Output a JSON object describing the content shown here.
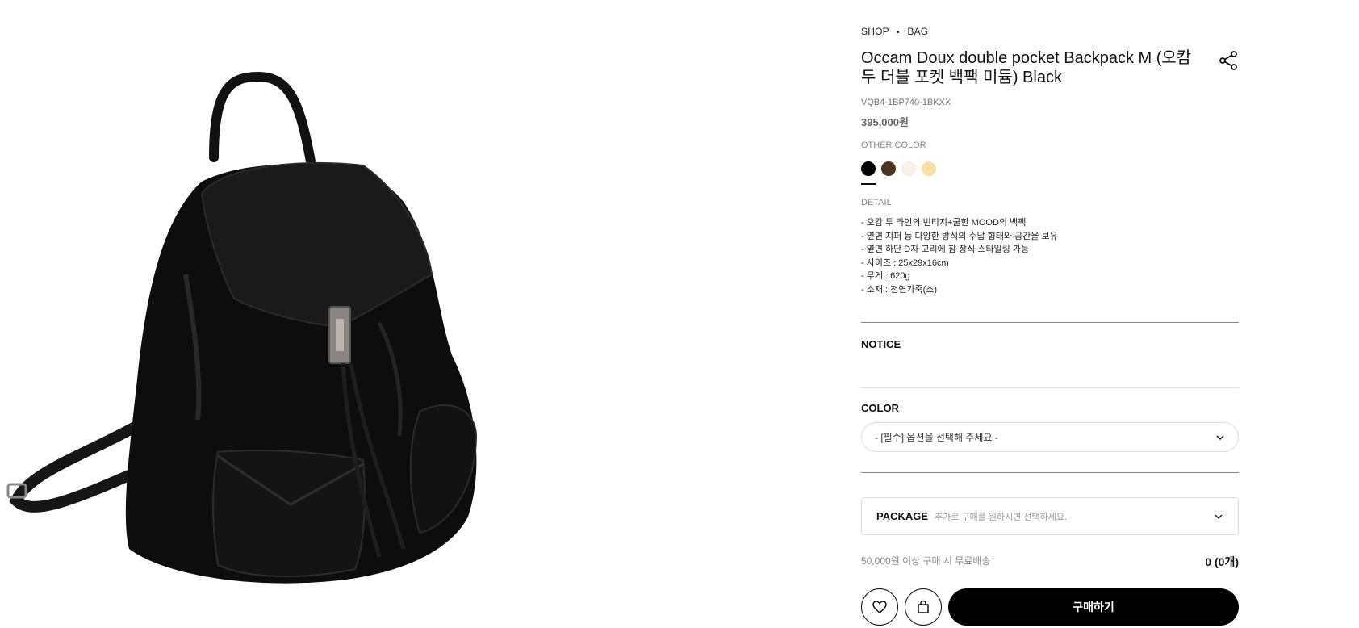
{
  "breadcrumb": {
    "shop": "SHOP",
    "separator": "•",
    "category": "BAG"
  },
  "product": {
    "title": "Occam Doux double pocket Backpack M (오캄 두 더블 포켓 백팩 미듐) Black",
    "sku": "VQB4-1BP740-1BKXX",
    "price": "395,000원",
    "image_alt": "black leather backpack"
  },
  "other_color": {
    "label": "OTHER COLOR",
    "swatches": [
      {
        "name": "black",
        "color": "#000000",
        "selected": true
      },
      {
        "name": "brown",
        "color": "#4a3520",
        "selected": false
      },
      {
        "name": "cream",
        "color": "#faf2e6",
        "selected": false
      },
      {
        "name": "beige",
        "color": "#fbe0a6",
        "selected": false
      }
    ]
  },
  "detail": {
    "label": "DETAIL",
    "lines": [
      "- 오캄 두 라인의 빈티지+쿨한 MOOD의 백팩",
      "- 옆면 지퍼 등 다양한 방식의 수납 형태와 공간을 보유",
      "- 옆면 하단 D자 고리에 참 장식 스타일링 가능",
      "- 사이즈 : 25x29x16cm",
      "- 무게 : 620g",
      "- 소재 : 천연가죽(소)"
    ]
  },
  "notice": {
    "label": "NOTICE"
  },
  "color_option": {
    "label": "COLOR",
    "placeholder": "- [필수] 옵션을 선택해 주세요 -"
  },
  "package": {
    "label": "PACKAGE",
    "hint": "추가로 구매를 원하시면 선택하세요."
  },
  "shipping": {
    "text": "50,000원 이상 구매 시 무료배송"
  },
  "total": {
    "text": "0 (0개)"
  },
  "actions": {
    "buy_label": "구매하기"
  },
  "icons": {
    "share": "share-icon",
    "heart": "heart-icon",
    "bag": "shopping-bag-icon",
    "chevron": "chevron-down-icon"
  }
}
